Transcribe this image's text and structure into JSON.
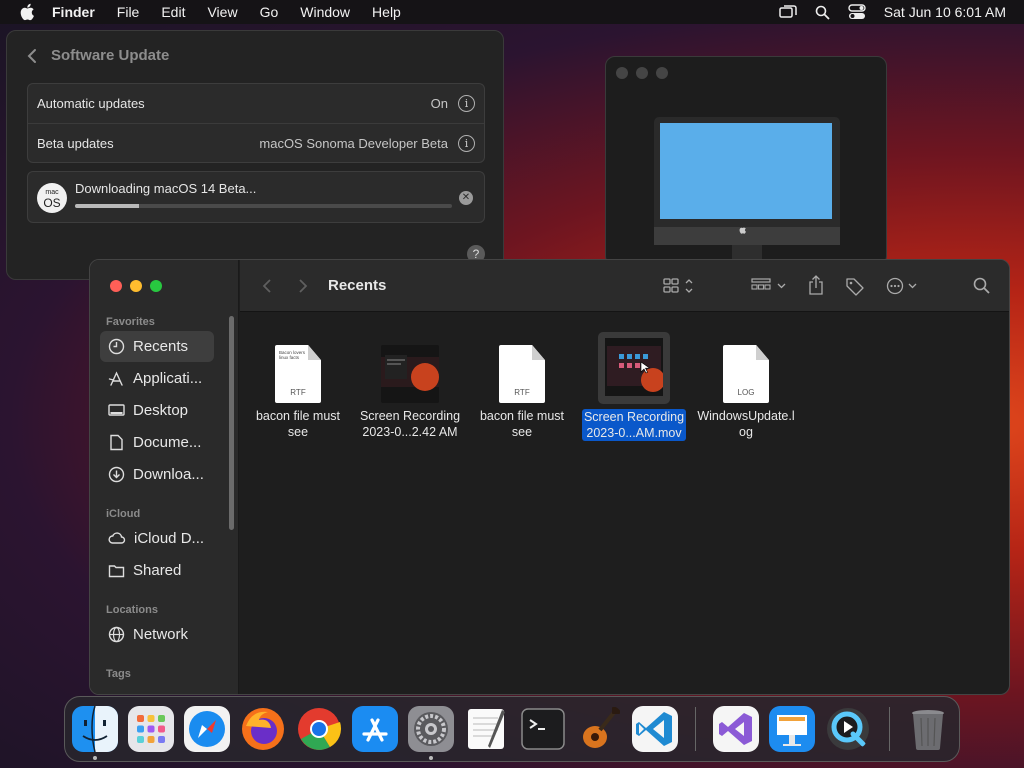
{
  "menubar": {
    "app_name": "Finder",
    "menus": [
      "File",
      "Edit",
      "View",
      "Go",
      "Window",
      "Help"
    ],
    "datetime": "Sat Jun 10  6:01 AM"
  },
  "software_update": {
    "title": "Software Update",
    "rows": [
      {
        "label": "Automatic updates",
        "value": "On"
      },
      {
        "label": "Beta updates",
        "value": "macOS Sonoma Developer Beta"
      }
    ],
    "download": {
      "badge_top": "mac",
      "badge_bottom": "OS",
      "text": "Downloading macOS 14 Beta...",
      "progress": 0.17
    },
    "help": "?"
  },
  "finder": {
    "title": "Recents",
    "sidebar": {
      "favorites_label": "Favorites",
      "favorites": [
        "Recents",
        "Applicati...",
        "Desktop",
        "Docume...",
        "Downloa..."
      ],
      "icloud_label": "iCloud",
      "icloud": [
        "iCloud D...",
        "Shared"
      ],
      "locations_label": "Locations",
      "locations": [
        "Network"
      ],
      "tags_label": "Tags"
    },
    "files": [
      {
        "name_l1": "bacon file must",
        "name_l2": "see",
        "kind": "RTF",
        "preview_l1": "Bacon lovers",
        "preview_l2": "linux facts"
      },
      {
        "name_l1": "Screen Recording",
        "name_l2": "2023-0...2.42 AM",
        "kind": "video"
      },
      {
        "name_l1": "bacon file must",
        "name_l2": "see",
        "kind": "RTF"
      },
      {
        "name_l1": "Screen Recording",
        "name_l2": "2023-0...AM.mov",
        "kind": "video",
        "selected": true
      },
      {
        "name_l1": "WindowsUpdate.l",
        "name_l2": "og",
        "kind": "LOG"
      }
    ]
  },
  "dock": {
    "apps": [
      "finder-icon",
      "launchpad-icon",
      "safari-icon",
      "firefox-icon",
      "chrome-icon",
      "app-store-icon",
      "system-settings-icon",
      "textedit-icon",
      "terminal-icon",
      "garageband-icon",
      "vscode-icon",
      "visual-studio-icon",
      "keynote-icon",
      "quicktime-icon",
      "trash-icon"
    ]
  }
}
